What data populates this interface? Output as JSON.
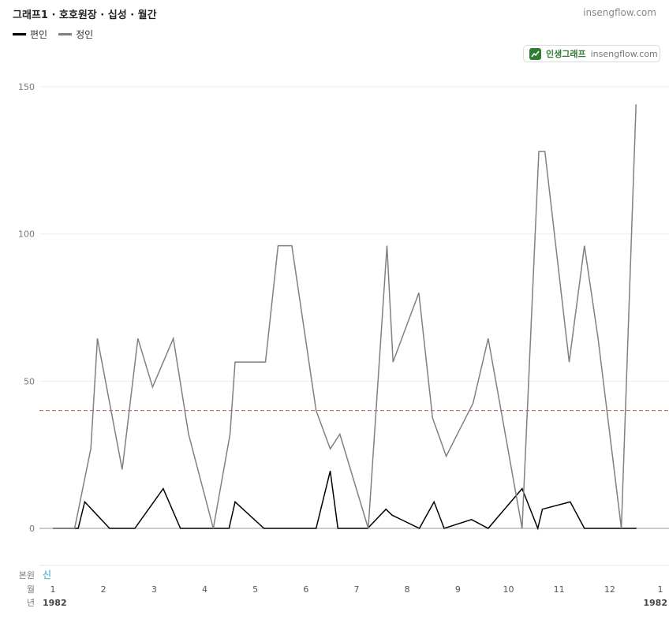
{
  "header": {
    "title": "그래프1 · 호호원장 · 십성 · 월간",
    "site": "insengflow.com"
  },
  "badge": {
    "name": "인생그래프",
    "site": "insengflow.com"
  },
  "bottom_rows": {
    "row1_label": "본원",
    "row1_value": "신",
    "row2_label": "월",
    "row3_label": "년"
  },
  "colors": {
    "series_a": "#000000",
    "series_b": "#808080",
    "reference": "#d9534f"
  },
  "chart_data": {
    "type": "line",
    "ylim": [
      0,
      150
    ],
    "yticks": [
      0,
      50,
      100,
      150
    ],
    "xlim": [
      1,
      13
    ],
    "reference_line": 40,
    "month_ticks": [
      {
        "x": 1,
        "label": "1"
      },
      {
        "x": 2,
        "label": "2"
      },
      {
        "x": 3,
        "label": "3"
      },
      {
        "x": 4,
        "label": "4"
      },
      {
        "x": 5,
        "label": "5"
      },
      {
        "x": 6,
        "label": "6"
      },
      {
        "x": 7,
        "label": "7"
      },
      {
        "x": 8,
        "label": "8"
      },
      {
        "x": 9,
        "label": "9"
      },
      {
        "x": 10,
        "label": "10"
      },
      {
        "x": 11,
        "label": "11"
      },
      {
        "x": 12,
        "label": "12"
      },
      {
        "x": 13,
        "label": "1"
      }
    ],
    "year_ticks": [
      {
        "x": 1,
        "label": "1982"
      },
      {
        "x": 13,
        "label": "1982"
      }
    ],
    "series": [
      {
        "name": "편인",
        "color": "#000000",
        "points": [
          [
            1.0,
            0
          ],
          [
            1.5,
            0
          ],
          [
            1.63,
            9
          ],
          [
            2.12,
            0
          ],
          [
            2.62,
            0
          ],
          [
            3.18,
            13.5
          ],
          [
            3.52,
            0
          ],
          [
            4.12,
            0
          ],
          [
            4.48,
            0
          ],
          [
            4.6,
            9
          ],
          [
            5.17,
            0
          ],
          [
            6.2,
            0
          ],
          [
            6.48,
            19.5
          ],
          [
            6.63,
            0
          ],
          [
            7.22,
            0
          ],
          [
            7.58,
            6.5
          ],
          [
            7.7,
            4.5
          ],
          [
            8.24,
            0
          ],
          [
            8.53,
            9
          ],
          [
            8.73,
            0
          ],
          [
            9.27,
            3
          ],
          [
            9.6,
            0
          ],
          [
            10.27,
            13.5
          ],
          [
            10.58,
            0
          ],
          [
            10.67,
            6.5
          ],
          [
            11.22,
            9
          ],
          [
            11.5,
            0
          ],
          [
            12.2,
            0
          ],
          [
            12.53,
            0
          ]
        ]
      },
      {
        "name": "정인",
        "color": "#808080",
        "points": [
          [
            1.0,
            0
          ],
          [
            1.43,
            0
          ],
          [
            1.75,
            27
          ],
          [
            1.88,
            64.5
          ],
          [
            2.37,
            20
          ],
          [
            2.68,
            64.5
          ],
          [
            2.97,
            48
          ],
          [
            3.38,
            64.5
          ],
          [
            3.68,
            32
          ],
          [
            4.17,
            0
          ],
          [
            4.5,
            32
          ],
          [
            4.6,
            56.5
          ],
          [
            5.2,
            56.5
          ],
          [
            5.45,
            96
          ],
          [
            5.72,
            96
          ],
          [
            6.2,
            40
          ],
          [
            6.48,
            27
          ],
          [
            6.67,
            32
          ],
          [
            7.23,
            0
          ],
          [
            7.6,
            96
          ],
          [
            7.72,
            56.5
          ],
          [
            8.23,
            80
          ],
          [
            8.5,
            37.5
          ],
          [
            8.77,
            24.5
          ],
          [
            9.3,
            42.5
          ],
          [
            9.6,
            64.5
          ],
          [
            10.27,
            0
          ],
          [
            10.6,
            128
          ],
          [
            10.72,
            128
          ],
          [
            11.2,
            56.5
          ],
          [
            11.5,
            96
          ],
          [
            11.77,
            64.5
          ],
          [
            12.23,
            0
          ],
          [
            12.52,
            144
          ]
        ]
      }
    ]
  }
}
